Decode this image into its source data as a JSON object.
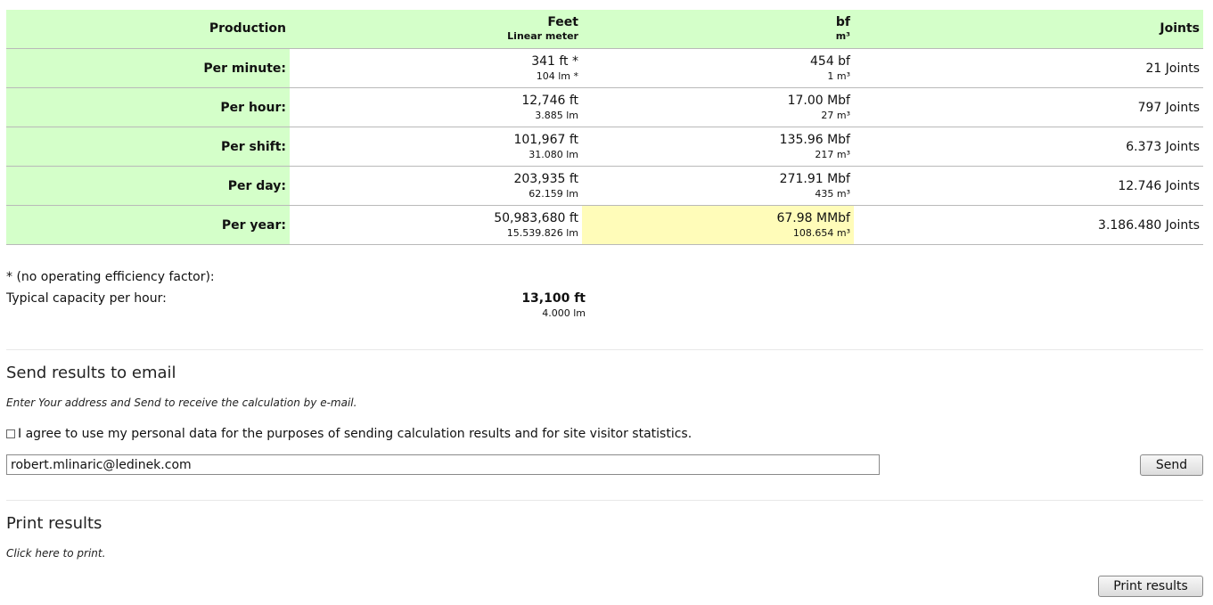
{
  "table": {
    "headers": {
      "production": "Production",
      "feet": "Feet",
      "feet_sub": "Linear meter",
      "bf": "bf",
      "bf_sub": "m³",
      "joints": "Joints"
    },
    "rows": [
      {
        "label": "Per minute:",
        "feet": "341 ft *",
        "feet_sub": "104 lm *",
        "bf": "454 bf",
        "bf_sub": "1 m³",
        "joints": "21 Joints"
      },
      {
        "label": "Per hour:",
        "feet": "12,746 ft",
        "feet_sub": "3.885 lm",
        "bf": "17.00 Mbf",
        "bf_sub": "27 m³",
        "joints": "797 Joints"
      },
      {
        "label": "Per shift:",
        "feet": "101,967 ft",
        "feet_sub": "31.080 lm",
        "bf": "135.96 Mbf",
        "bf_sub": "217 m³",
        "joints": "6.373 Joints"
      },
      {
        "label": "Per day:",
        "feet": "203,935 ft",
        "feet_sub": "62.159 lm",
        "bf": "271.91 Mbf",
        "bf_sub": "435 m³",
        "joints": "12.746 Joints"
      },
      {
        "label": "Per year:",
        "feet": "50,983,680 ft",
        "feet_sub": "15.539.826 lm",
        "bf": "67.98 MMbf",
        "bf_sub": "108.654 m³",
        "joints": "3.186.480 Joints"
      }
    ]
  },
  "note": "* (no operating efficiency factor):",
  "capacity": {
    "label": "Typical capacity per hour:",
    "value": "13,100 ft",
    "value_sub": "4.000 lm"
  },
  "email_section": {
    "title": "Send results to email",
    "hint": "Enter Your address and Send to receive the calculation by e-mail.",
    "consent": "I agree to use my personal data for the purposes of sending calculation results and for site visitor statistics.",
    "email_value": "robert.mlinaric@ledinek.com",
    "send_label": "Send"
  },
  "print_section": {
    "title": "Print results",
    "hint": "Click here to print.",
    "button_label": "Print results"
  },
  "colors": {
    "label_bg": "#d4ffc9",
    "highlight_bg": "#fffcb9"
  }
}
